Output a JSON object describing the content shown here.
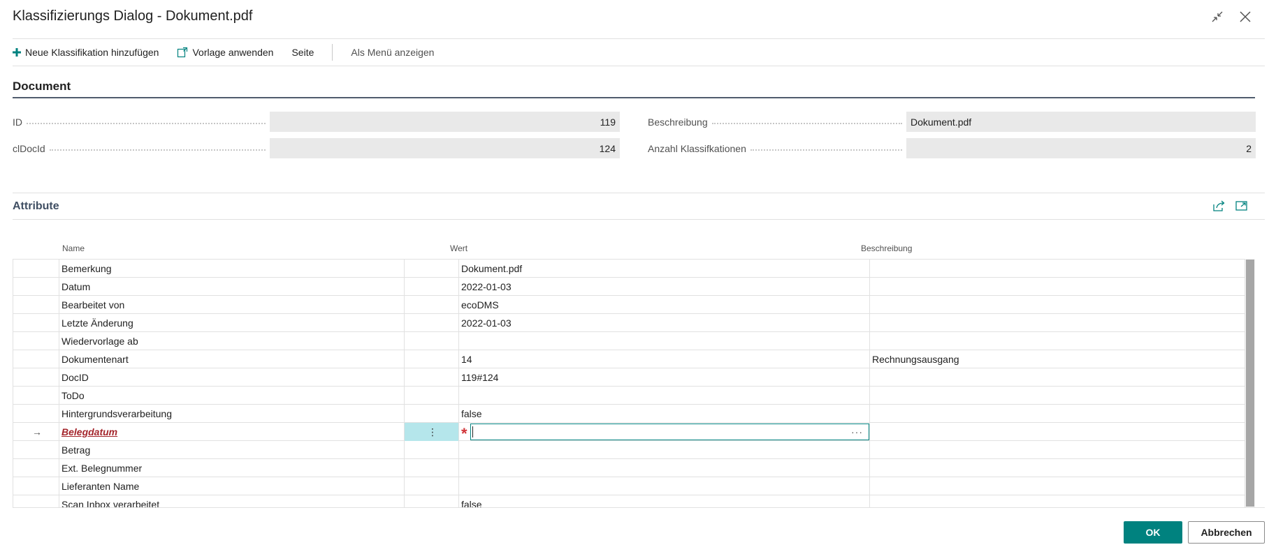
{
  "dialog": {
    "title": "Klassifizierungs Dialog - Dokument.pdf",
    "collapse_icon": "collapse-icon",
    "close_icon": "close-icon"
  },
  "toolbar": {
    "add_label": "Neue Klassifikation hinzufügen",
    "template_label": "Vorlage anwenden",
    "page_label": "Seite",
    "menu_label": "Als Menü anzeigen"
  },
  "document": {
    "section_title": "Document",
    "id_label": "ID",
    "id_value": "119",
    "cldocid_label": "clDocId",
    "cldocid_value": "124",
    "beschreibung_label": "Beschreibung",
    "beschreibung_value": "Dokument.pdf",
    "anzahl_label": "Anzahl Klassifkationen",
    "anzahl_value": "2"
  },
  "attributes": {
    "section_title": "Attribute",
    "columns": {
      "name": "Name",
      "value": "Wert",
      "description": "Beschreibung"
    },
    "rows": [
      {
        "name": "Bemerkung",
        "value": "Dokument.pdf",
        "description": ""
      },
      {
        "name": "Datum",
        "value": "2022-01-03",
        "description": ""
      },
      {
        "name": "Bearbeitet von",
        "value": "ecoDMS",
        "description": ""
      },
      {
        "name": "Letzte Änderung",
        "value": "2022-01-03",
        "description": ""
      },
      {
        "name": "Wiedervorlage ab",
        "value": "",
        "description": ""
      },
      {
        "name": "Dokumentenart",
        "value": "14",
        "description": "Rechnungsausgang"
      },
      {
        "name": "DocID",
        "value": "119#124",
        "description": ""
      },
      {
        "name": "ToDo",
        "value": "",
        "description": ""
      },
      {
        "name": "Hintergrundsverarbeitung",
        "value": "false",
        "description": ""
      },
      {
        "name": "Belegdatum",
        "value": "",
        "description": "",
        "active": true,
        "required": true
      },
      {
        "name": "Betrag",
        "value": "",
        "description": ""
      },
      {
        "name": "Ext. Belegnummer",
        "value": "",
        "description": ""
      },
      {
        "name": "Lieferanten Name",
        "value": "",
        "description": ""
      },
      {
        "name": "Scan Inbox verarbeitet",
        "value": "false",
        "description": ""
      }
    ],
    "active_arrow": "→",
    "row_menu": "⋮",
    "required_mark": "*",
    "lookup": "···"
  },
  "footer": {
    "ok_label": "OK",
    "cancel_label": "Abbrechen"
  }
}
